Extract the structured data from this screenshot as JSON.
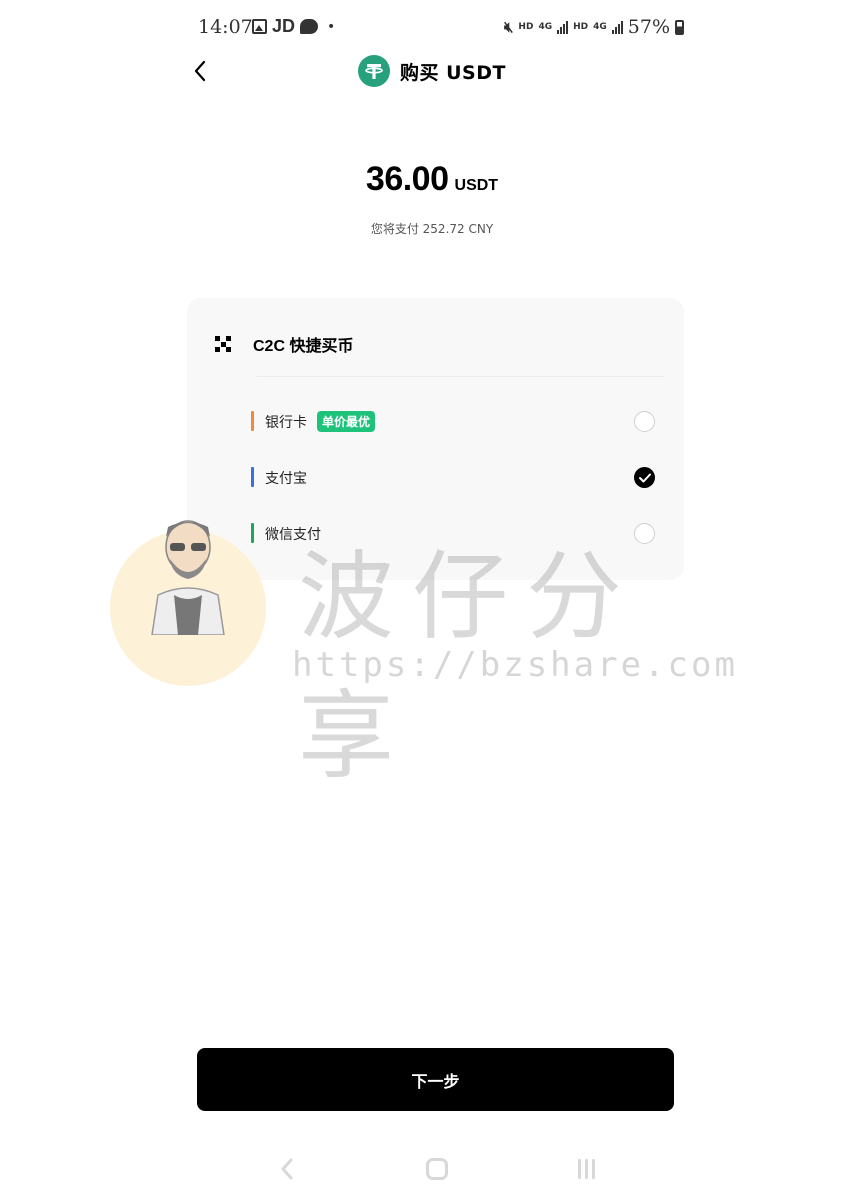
{
  "status_bar": {
    "time": "14:07",
    "notification_text": "JD",
    "network_1": "HD",
    "network_2": "4G",
    "network_3": "HD",
    "network_4": "4G",
    "battery": "57%"
  },
  "header": {
    "title": "购买 USDT",
    "coin_icon": "tether-icon",
    "back_icon": "chevron-left-icon"
  },
  "amount": {
    "value": "36.00",
    "unit": "USDT",
    "pay_hint": "您将支付 252.72 CNY"
  },
  "card": {
    "title": "C2C 快捷买币",
    "icon": "c2c-icon",
    "options": [
      {
        "label": "银行卡",
        "badge": "单价最优",
        "selected": false,
        "accent": "#f08a3c"
      },
      {
        "label": "支付宝",
        "badge": "",
        "selected": true,
        "accent": "#3b6fe0"
      },
      {
        "label": "微信支付",
        "badge": "",
        "selected": false,
        "accent": "#22a35a"
      }
    ],
    "badge_color": "#1fc27a"
  },
  "watermark": {
    "title": "波仔分享",
    "url": "https://bzshare.com"
  },
  "next_button": {
    "label": "下一步"
  },
  "colors": {
    "primary": "#000000",
    "tether": "#26a17b",
    "card_bg": "#f8f8f8"
  }
}
